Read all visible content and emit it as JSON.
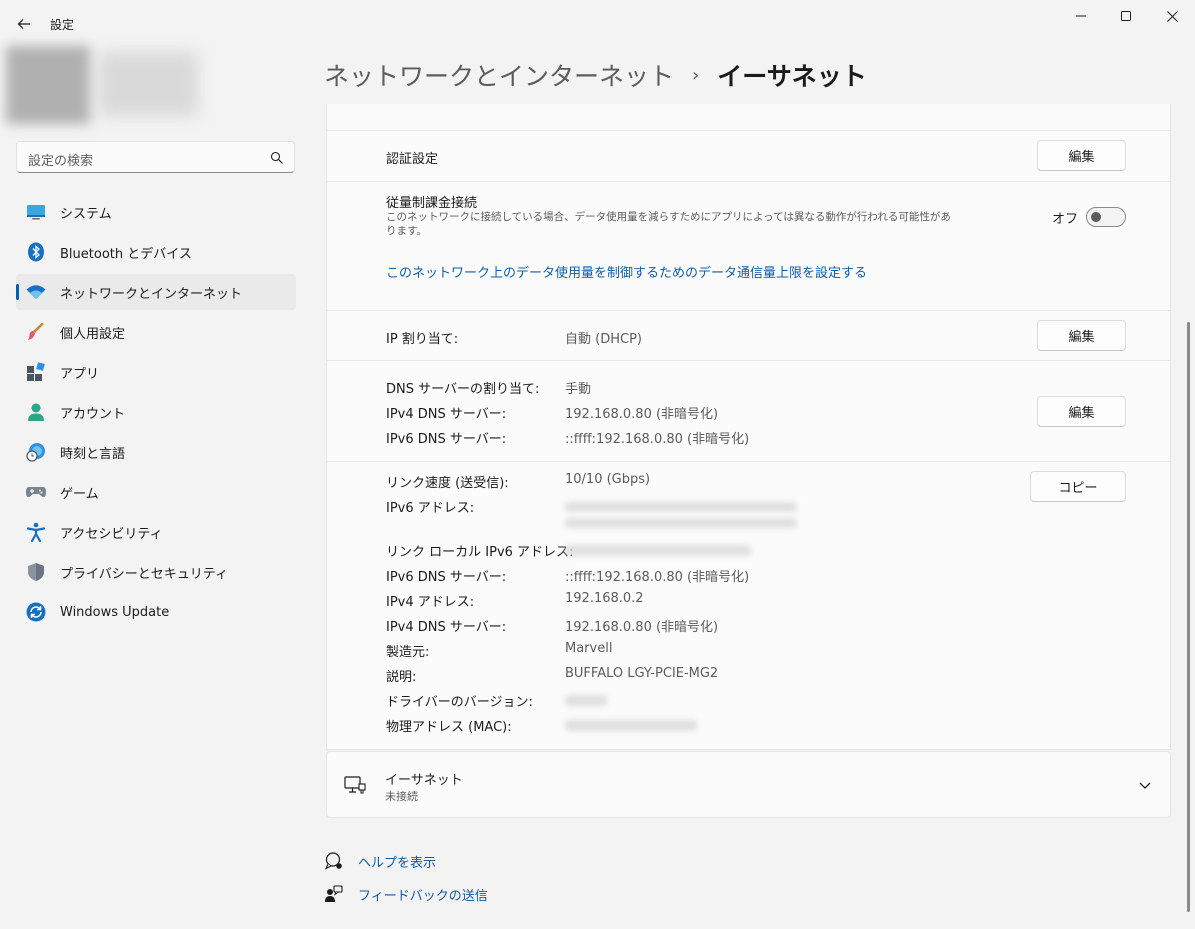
{
  "window": {
    "app_title": "設定"
  },
  "search": {
    "placeholder": "設定の検索"
  },
  "nav": {
    "items": [
      {
        "label": "システム",
        "icon": "system-icon"
      },
      {
        "label": "Bluetooth とデバイス",
        "icon": "bluetooth-icon"
      },
      {
        "label": "ネットワークとインターネット",
        "icon": "wifi-icon",
        "selected": true
      },
      {
        "label": "個人用設定",
        "icon": "brush-icon"
      },
      {
        "label": "アプリ",
        "icon": "apps-icon"
      },
      {
        "label": "アカウント",
        "icon": "account-icon"
      },
      {
        "label": "時刻と言語",
        "icon": "time-language-icon"
      },
      {
        "label": "ゲーム",
        "icon": "gamepad-icon"
      },
      {
        "label": "アクセシビリティ",
        "icon": "accessibility-icon"
      },
      {
        "label": "プライバシーとセキュリティ",
        "icon": "shield-icon"
      },
      {
        "label": "Windows Update",
        "icon": "update-icon"
      }
    ]
  },
  "header": {
    "parent": "ネットワークとインターネット",
    "separator": "›",
    "current": "イーサネット"
  },
  "auth": {
    "label": "認証設定",
    "button": "編集"
  },
  "metered": {
    "label": "従量制課金接続",
    "description": "このネットワークに接続している場合、データ使用量を減らすためにアプリによっては異なる動作が行われる可能性があります。",
    "state": "オフ",
    "link": "このネットワーク上のデータ使用量を制御するためのデータ通信量上限を設定する"
  },
  "ip_assign": {
    "label": "IP 割り当て:",
    "value": "自動 (DHCP)",
    "button": "編集"
  },
  "dns": {
    "rows": [
      {
        "label": "DNS サーバーの割り当て:",
        "value": "手動"
      },
      {
        "label": "IPv4 DNS サーバー:",
        "value": "192.168.0.80 (非暗号化)"
      },
      {
        "label": "IPv6 DNS サーバー:",
        "value": "::ffff:192.168.0.80 (非暗号化)"
      }
    ],
    "button": "編集"
  },
  "properties": {
    "button": "コピー",
    "rows": [
      {
        "label": "リンク速度 (送受信):",
        "value": "10/10 (Gbps)"
      },
      {
        "label": "IPv6 アドレス:",
        "value": ""
      },
      {
        "label": "リンク ローカル IPv6 アドレス:",
        "value": ""
      },
      {
        "label": "IPv6 DNS サーバー:",
        "value": "::ffff:192.168.0.80 (非暗号化)"
      },
      {
        "label": "IPv4 アドレス:",
        "value": "192.168.0.2"
      },
      {
        "label": "IPv4 DNS サーバー:",
        "value": "192.168.0.80 (非暗号化)"
      },
      {
        "label": "製造元:",
        "value": "Marvell"
      },
      {
        "label": "説明:",
        "value": "BUFFALO LGY-PCIE-MG2"
      },
      {
        "label": "ドライバーのバージョン:",
        "value": ""
      },
      {
        "label": "物理アドレス (MAC):",
        "value": ""
      }
    ]
  },
  "ethernet2": {
    "title": "イーサネット",
    "status": "未接続"
  },
  "footer": {
    "help": "ヘルプを表示",
    "feedback": "フィードバックの送信"
  },
  "colors": {
    "accent": "#005fb8",
    "link": "#0f5ca8"
  }
}
